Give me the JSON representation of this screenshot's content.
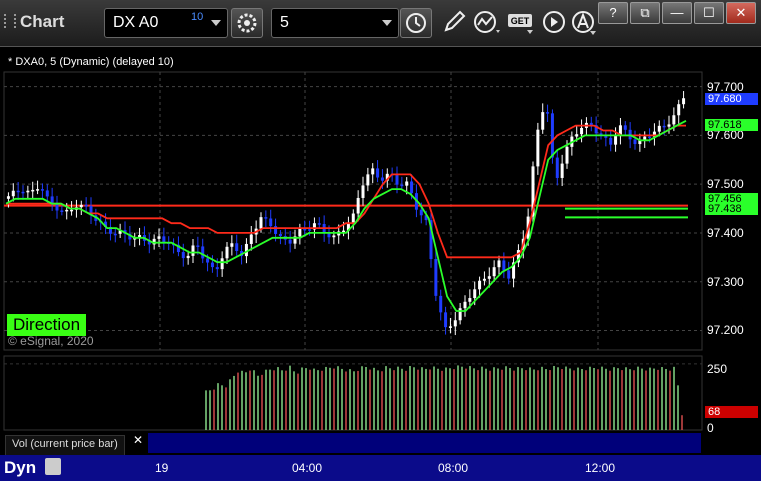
{
  "toolbar": {
    "title": "Chart",
    "symbol": "DX A0",
    "symbol_badge": "10",
    "interval": "5",
    "window_buttons": [
      "?",
      "⧉",
      "—",
      "☐",
      "✕"
    ],
    "icons": [
      "settings-icon",
      "clock-icon",
      "pencil-icon",
      "studies-icon",
      "get-icon",
      "play-icon",
      "alert-icon"
    ]
  },
  "legend": "* DXA0, 5 (Dynamic) (delayed 10)",
  "direction_label": "Direction",
  "copyright": "© eSignal, 2020",
  "volume_label": "Vol (current price bar)",
  "bottom_label": "Dyn",
  "colors": {
    "up": "#ffffff",
    "down": "#1f3cff",
    "ma_slow": "#ff2a1a",
    "ma_fast": "#2aff2a",
    "vol_up": "#8fe88f",
    "vol_down": "#e05050",
    "badge_blue": "#1f3cff",
    "badge_green": "#2aff2a",
    "badge_red": "#cc0000"
  },
  "chart_data": [
    {
      "type": "candlestick",
      "title": "",
      "x_ticks": [
        "19",
        "04:00",
        "08:00",
        "12:00"
      ],
      "y_ticks": [
        97.2,
        97.3,
        97.4,
        97.5,
        97.6,
        97.7
      ],
      "ylim": [
        97.16,
        97.73
      ],
      "price_labels": {
        "last": "97.680",
        "fast_ma": "97.618",
        "level_1": "97.456",
        "level_2": "97.438"
      },
      "horizontal_levels": {
        "red": 97.456,
        "green_upper": 97.456,
        "green_lower": 97.438
      },
      "close_path": [
        97.47,
        97.48,
        97.49,
        97.48,
        97.5,
        97.46,
        97.45,
        97.44,
        97.46,
        97.45,
        97.43,
        97.41,
        97.4,
        97.4,
        97.39,
        97.39,
        97.38,
        97.39,
        97.38,
        97.36,
        97.35,
        97.38,
        97.34,
        97.32,
        97.36,
        97.38,
        97.35,
        97.4,
        97.43,
        97.42,
        97.39,
        97.38,
        97.4,
        97.41,
        97.42,
        97.4,
        97.39,
        97.41,
        97.43,
        97.5,
        97.53,
        97.51,
        97.52,
        97.5,
        97.5,
        97.45,
        97.42,
        97.28,
        97.2,
        97.22,
        97.25,
        97.28,
        97.3,
        97.32,
        97.34,
        97.31,
        97.36,
        97.42,
        97.6,
        97.68,
        97.5,
        97.56,
        97.6,
        97.62,
        97.62,
        97.6,
        97.58,
        97.62,
        97.6,
        97.58,
        97.6,
        97.61,
        97.62,
        97.64,
        97.68
      ],
      "fast_ma_path": [
        97.46,
        97.47,
        97.47,
        97.47,
        97.47,
        97.46,
        97.46,
        97.45,
        97.45,
        97.44,
        97.43,
        97.41,
        97.41,
        97.4,
        97.39,
        97.39,
        97.38,
        97.38,
        97.38,
        97.37,
        97.36,
        97.36,
        97.35,
        97.34,
        97.34,
        97.35,
        97.36,
        97.37,
        97.38,
        97.39,
        97.39,
        97.39,
        97.39,
        97.4,
        97.4,
        97.4,
        97.4,
        97.4,
        97.42,
        97.45,
        97.47,
        97.48,
        97.49,
        97.49,
        97.48,
        97.46,
        97.43,
        97.35,
        97.27,
        97.24,
        97.24,
        97.26,
        97.28,
        97.3,
        97.32,
        97.33,
        97.35,
        97.39,
        97.47,
        97.55,
        97.57,
        97.58,
        97.59,
        97.6,
        97.6,
        97.6,
        97.6,
        97.6,
        97.6,
        97.59,
        97.59,
        97.6,
        97.61,
        97.62,
        97.63
      ],
      "slow_ma_path": [
        97.46,
        97.46,
        97.46,
        97.46,
        97.46,
        97.46,
        97.46,
        97.45,
        97.45,
        97.44,
        97.44,
        97.43,
        97.43,
        97.43,
        97.43,
        97.43,
        97.43,
        97.43,
        97.42,
        97.42,
        97.41,
        97.41,
        97.41,
        97.4,
        97.4,
        97.4,
        97.4,
        97.4,
        97.41,
        97.41,
        97.41,
        97.41,
        97.41,
        97.41,
        97.41,
        97.41,
        97.41,
        97.42,
        97.42,
        97.44,
        97.47,
        97.5,
        97.52,
        97.52,
        97.52,
        97.5,
        97.46,
        97.4,
        97.35,
        97.35,
        97.35,
        97.35,
        97.35,
        97.35,
        97.35,
        97.35,
        97.36,
        97.42,
        97.5,
        97.58,
        97.6,
        97.61,
        97.62,
        97.62,
        97.62,
        97.61,
        97.61,
        97.6,
        97.6,
        97.6,
        97.6,
        97.6,
        97.61,
        97.62,
        97.62
      ]
    },
    {
      "type": "bar",
      "title": "Vol (current price bar)",
      "y_ticks": [
        0,
        250
      ],
      "ylim": [
        0,
        280
      ],
      "last_value": "68",
      "volume_path": [
        150,
        160,
        180,
        170,
        200,
        230,
        220,
        240,
        210,
        225,
        235,
        240,
        230,
        245,
        220,
        238,
        242,
        230,
        236,
        240,
        245,
        238,
        232,
        228,
        240,
        245,
        236,
        230,
        242,
        238,
        240,
        235,
        245,
        240,
        236,
        242,
        238,
        235,
        240,
        244,
        246,
        242,
        238,
        240,
        236,
        238,
        240,
        242,
        236,
        240,
        238,
        235,
        240,
        236,
        242,
        244,
        240,
        238,
        236,
        238,
        240,
        242,
        238,
        236,
        240,
        238,
        236,
        240,
        238,
        236,
        240,
        238,
        236,
        240,
        68
      ]
    }
  ]
}
